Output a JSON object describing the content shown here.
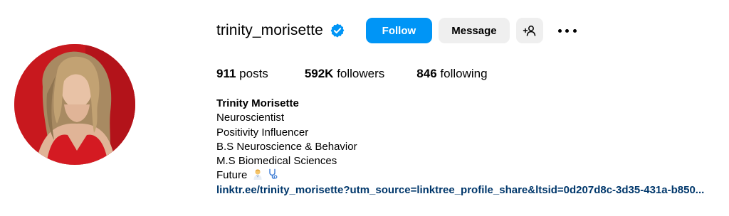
{
  "profile": {
    "username": "trinity_morisette",
    "verified": true,
    "avatar_alt": "profile photo",
    "buttons": {
      "follow": "Follow",
      "message": "Message"
    },
    "stats": {
      "posts_count": "911",
      "posts_label": "posts",
      "followers_count": "592K",
      "followers_label": "followers",
      "following_count": "846",
      "following_label": "following"
    },
    "bio": {
      "full_name": "Trinity Morisette",
      "lines": [
        "Neuroscientist",
        "Positivity Influencer",
        "B.S Neuroscience & Behavior",
        "M.S Biomedical Sciences",
        "Future"
      ],
      "emoji_icons": [
        "scientist-emoji",
        "stethoscope-emoji"
      ],
      "link": "linktr.ee/trinity_morisette?utm_source=linktree_profile_share&ltsid=0d207d8c-3d35-431a-b850..."
    }
  },
  "colors": {
    "follow_blue": "#0095f6",
    "secondary_button": "#efefef",
    "link_blue": "#00376b",
    "verified_blue": "#0095f6",
    "avatar_background": "#c8181e"
  }
}
